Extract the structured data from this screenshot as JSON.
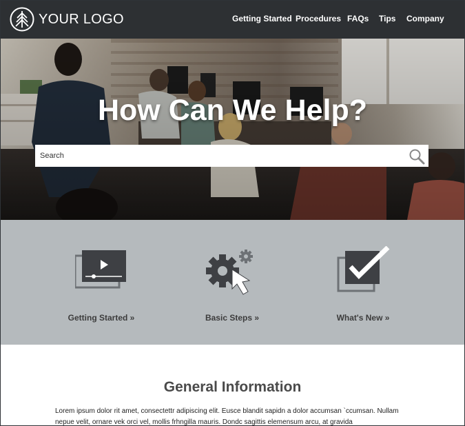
{
  "header": {
    "logo_text": "YOUR LOGO",
    "nav": [
      {
        "label": "Getting Started"
      },
      {
        "label": "Procedures"
      },
      {
        "label": "FAQs"
      },
      {
        "label": "Tips"
      },
      {
        "label": "Company"
      }
    ]
  },
  "hero": {
    "title": "How Can We Help?",
    "search_placeholder": "Search"
  },
  "features": [
    {
      "label": "Getting Started »",
      "icon": "video-player-icon"
    },
    {
      "label": "Basic Steps »",
      "icon": "gear-cursor-icon"
    },
    {
      "label": "What's New »",
      "icon": "checkbox-check-icon"
    }
  ],
  "info": {
    "title": "General Information",
    "text": "Lorem ipsum dolor rit amet, consectettr adipiscing elit. Eusce blandit sapidn a dolor accumsan `ccumsan. Nullam nepue velit, ornare vek orci vel, mollis frhngilla mauris. Dondc sagittis elemensum arcu, at gravida"
  },
  "colors": {
    "header_bg": "#2d3033",
    "features_bg": "#b5babd",
    "icon_dark": "#3e4044",
    "text_dark": "#4a4a4a"
  }
}
